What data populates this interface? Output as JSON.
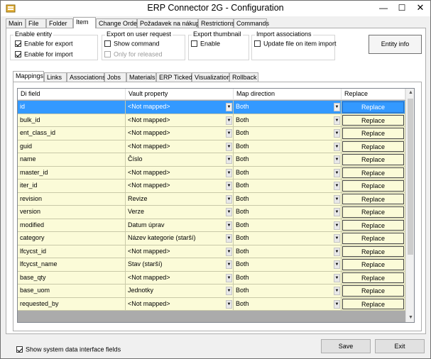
{
  "window": {
    "title": "ERP Connector 2G - Configuration",
    "minimize": "—",
    "maximize": "☐",
    "close": "✕"
  },
  "top_tabs": [
    {
      "label": "Main"
    },
    {
      "label": "File"
    },
    {
      "label": "Folder"
    },
    {
      "label": "Item",
      "active": true
    },
    {
      "label": "Change Order"
    },
    {
      "label": "Požadavek na nákup"
    },
    {
      "label": "Restrictions"
    },
    {
      "label": "Commands"
    }
  ],
  "enable_entity": {
    "title": "Enable entity",
    "export_label": "Enable for export",
    "export_checked": true,
    "import_label": "Enable for import",
    "import_checked": true
  },
  "export_on_request": {
    "title": "Export on user request",
    "show_command_label": "Show command",
    "only_released_label": "Only for released"
  },
  "export_thumbnail": {
    "title": "Export thumbnail",
    "enable_label": "Enable"
  },
  "import_associations": {
    "title": "Import associations",
    "update_label": "Update file on item import"
  },
  "entity_info_button": "Entity info",
  "inner_tabs": [
    {
      "label": "Mappings",
      "active": true
    },
    {
      "label": "Links"
    },
    {
      "label": "Associations"
    },
    {
      "label": "Jobs"
    },
    {
      "label": "Materials"
    },
    {
      "label": "ERP Ticked"
    },
    {
      "label": "Visualization"
    },
    {
      "label": "Rollback"
    }
  ],
  "grid": {
    "columns": [
      "Di field",
      "Vault property",
      "Map direction",
      "Replace"
    ],
    "rows": [
      {
        "field": "id",
        "property": "<Not mapped>",
        "direction": "Both",
        "replace": "Replace",
        "selected": true
      },
      {
        "field": "bulk_id",
        "property": "<Not mapped>",
        "direction": "Both",
        "replace": "Replace"
      },
      {
        "field": "ent_class_id",
        "property": "<Not mapped>",
        "direction": "Both",
        "replace": "Replace"
      },
      {
        "field": "guid",
        "property": "<Not mapped>",
        "direction": "Both",
        "replace": "Replace"
      },
      {
        "field": "name",
        "property": "Číslo",
        "direction": "Both",
        "replace": "Replace"
      },
      {
        "field": "master_id",
        "property": "<Not mapped>",
        "direction": "Both",
        "replace": "Replace"
      },
      {
        "field": "iter_id",
        "property": "<Not mapped>",
        "direction": "Both",
        "replace": "Replace"
      },
      {
        "field": "revision",
        "property": "Revize",
        "direction": "Both",
        "replace": "Replace"
      },
      {
        "field": "version",
        "property": "Verze",
        "direction": "Both",
        "replace": "Replace"
      },
      {
        "field": "modified",
        "property": "Datum úprav",
        "direction": "Both",
        "replace": "Replace"
      },
      {
        "field": "category",
        "property": "Název kategorie (starší)",
        "direction": "Both",
        "replace": "Replace"
      },
      {
        "field": "lfcycst_id",
        "property": "<Not mapped>",
        "direction": "Both",
        "replace": "Replace"
      },
      {
        "field": "lfcycst_name",
        "property": "Stav (starší)",
        "direction": "Both",
        "replace": "Replace"
      },
      {
        "field": "base_qty",
        "property": "<Not mapped>",
        "direction": "Both",
        "replace": "Replace"
      },
      {
        "field": "base_uom",
        "property": "Jednotky",
        "direction": "Both",
        "replace": "Replace"
      },
      {
        "field": "requested_by",
        "property": "<Not mapped>",
        "direction": "Both",
        "replace": "Replace"
      }
    ]
  },
  "show_system_fields": {
    "label": "Show system data interface fields",
    "checked": true
  },
  "save_button": "Save",
  "exit_button": "Exit"
}
